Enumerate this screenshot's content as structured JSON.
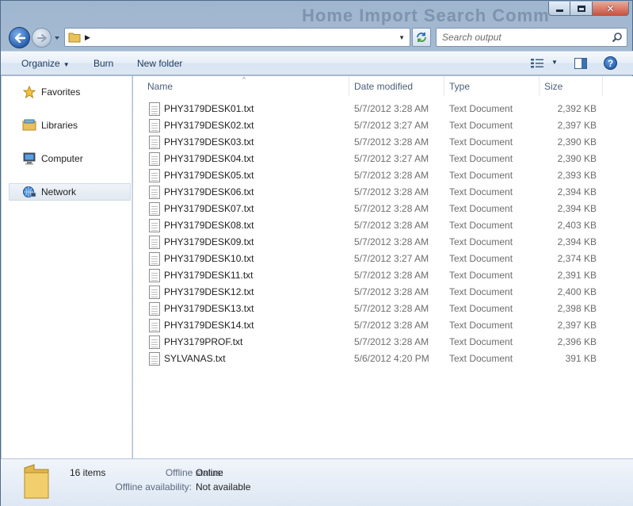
{
  "window": {
    "ghost_title": "Home Import Search Comm"
  },
  "nav": {
    "search_placeholder": "Search output"
  },
  "toolbar": {
    "organize": "Organize",
    "burn": "Burn",
    "new_folder": "New folder",
    "help": "?"
  },
  "sidebar": {
    "items": [
      {
        "label": "Favorites",
        "icon": "star-icon"
      },
      {
        "label": "Libraries",
        "icon": "libraries-icon"
      },
      {
        "label": "Computer",
        "icon": "computer-icon"
      },
      {
        "label": "Network",
        "icon": "network-icon",
        "selected": true
      }
    ]
  },
  "columns": {
    "name": "Name",
    "date": "Date modified",
    "type": "Type",
    "size": "Size"
  },
  "files": [
    {
      "name": "PHY3179DESK01.txt",
      "date": "5/7/2012 3:28 AM",
      "type": "Text Document",
      "size": "2,392 KB"
    },
    {
      "name": "PHY3179DESK02.txt",
      "date": "5/7/2012 3:27 AM",
      "type": "Text Document",
      "size": "2,397 KB"
    },
    {
      "name": "PHY3179DESK03.txt",
      "date": "5/7/2012 3:28 AM",
      "type": "Text Document",
      "size": "2,390 KB"
    },
    {
      "name": "PHY3179DESK04.txt",
      "date": "5/7/2012 3:27 AM",
      "type": "Text Document",
      "size": "2,390 KB"
    },
    {
      "name": "PHY3179DESK05.txt",
      "date": "5/7/2012 3:28 AM",
      "type": "Text Document",
      "size": "2,393 KB"
    },
    {
      "name": "PHY3179DESK06.txt",
      "date": "5/7/2012 3:28 AM",
      "type": "Text Document",
      "size": "2,394 KB"
    },
    {
      "name": "PHY3179DESK07.txt",
      "date": "5/7/2012 3:28 AM",
      "type": "Text Document",
      "size": "2,394 KB"
    },
    {
      "name": "PHY3179DESK08.txt",
      "date": "5/7/2012 3:28 AM",
      "type": "Text Document",
      "size": "2,403 KB"
    },
    {
      "name": "PHY3179DESK09.txt",
      "date": "5/7/2012 3:28 AM",
      "type": "Text Document",
      "size": "2,394 KB"
    },
    {
      "name": "PHY3179DESK10.txt",
      "date": "5/7/2012 3:27 AM",
      "type": "Text Document",
      "size": "2,374 KB"
    },
    {
      "name": "PHY3179DESK11.txt",
      "date": "5/7/2012 3:28 AM",
      "type": "Text Document",
      "size": "2,391 KB"
    },
    {
      "name": "PHY3179DESK12.txt",
      "date": "5/7/2012 3:28 AM",
      "type": "Text Document",
      "size": "2,400 KB"
    },
    {
      "name": "PHY3179DESK13.txt",
      "date": "5/7/2012 3:28 AM",
      "type": "Text Document",
      "size": "2,398 KB"
    },
    {
      "name": "PHY3179DESK14.txt",
      "date": "5/7/2012 3:28 AM",
      "type": "Text Document",
      "size": "2,397 KB"
    },
    {
      "name": "PHY3179PROF.txt",
      "date": "5/7/2012 3:28 AM",
      "type": "Text Document",
      "size": "2,396 KB"
    },
    {
      "name": "SYLVANAS.txt",
      "date": "5/6/2012 4:20 PM",
      "type": "Text Document",
      "size": "391 KB"
    }
  ],
  "details": {
    "count": "16 items",
    "offline_status_label": "Offline status:",
    "offline_status_value": "Online",
    "offline_avail_label": "Offline availability:",
    "offline_avail_value": "Not available"
  },
  "colors": {
    "frame": "#a9bfd6",
    "toolbar_text": "#1e395b",
    "header_text": "#4c607a",
    "meta_text": "#6d6d6d"
  }
}
